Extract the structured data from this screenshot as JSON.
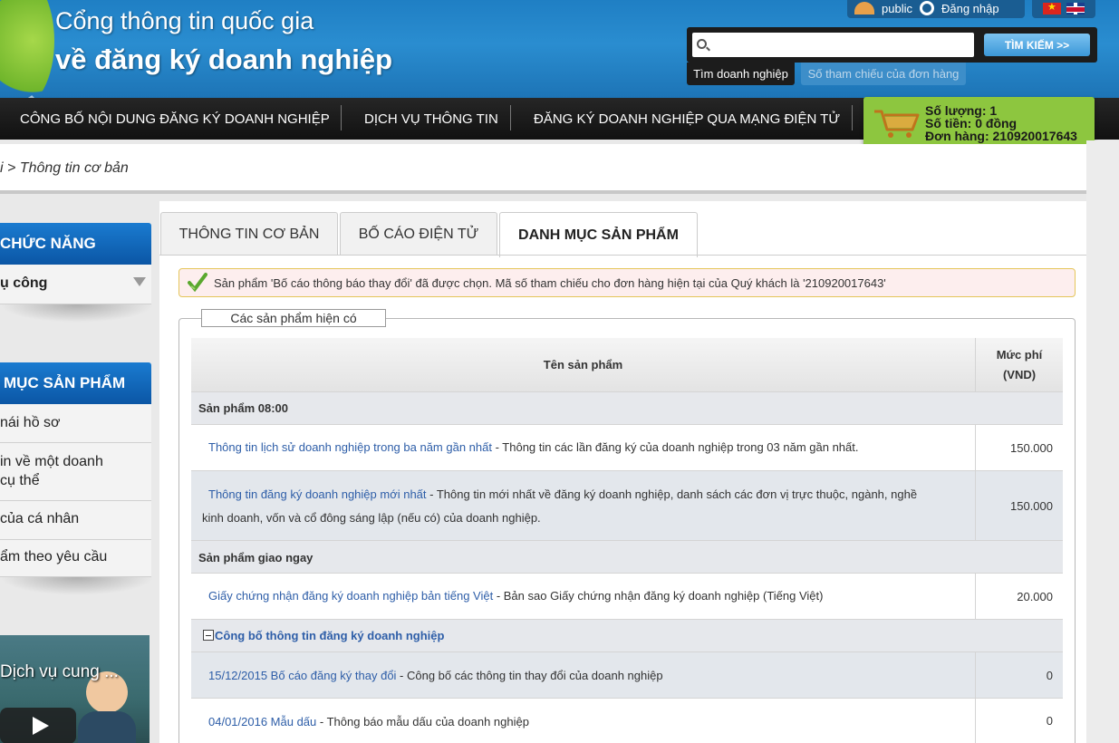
{
  "header": {
    "title_line1": "Cổng thông tin quốc gia",
    "title_line2": "về đăng ký doanh nghiệp",
    "user_name": "public",
    "login_label": "Đăng nhập"
  },
  "search": {
    "placeholder": "",
    "button_label": "TÌM KIẾM >>",
    "tabs": [
      "Tìm doanh nghiệp",
      "Số tham chiếu của đơn hàng"
    ]
  },
  "nav": {
    "items": [
      "CÔNG BỐ NỘI DUNG ĐĂNG KÝ DOANH NGHIỆP",
      "DỊCH VỤ THÔNG TIN",
      "ĐĂNG KÝ DOANH NGHIỆP QUA MẠNG ĐIỆN TỬ"
    ]
  },
  "cart": {
    "quantity": "Số lượng: 1",
    "amount": "Số tiền: 0 đồng",
    "order": "Đơn hàng: 210920017643"
  },
  "breadcrumb": {
    "text": "i > Thông tin cơ bản"
  },
  "sidebar": {
    "section1_title": "CHỨC NĂNG",
    "section1_items": [
      "ụ công"
    ],
    "section2_title": "MỤC SẢN PHẨM",
    "section2_items": [
      "nái hồ sơ",
      "in về một doanh",
      "cụ thể",
      "của cá nhân",
      "ẩm theo yêu cầu"
    ],
    "video_title": "Dịch vụ cung ..."
  },
  "tabs": [
    "THÔNG TIN CƠ BẢN",
    "BỐ CÁO ĐIỆN TỬ",
    "DANH MỤC SẢN PHẨM"
  ],
  "alert": {
    "message": "Sản phẩm 'Bố cáo thông báo thay đổi' đã được chọn. Mã số tham chiếu cho đơn hàng hiện tại của Quý khách là '210920017643'"
  },
  "products": {
    "legend": "Các sản phẩm hiện có",
    "col_name": "Tên sản phẩm",
    "col_fee_1": "Mức phí",
    "col_fee_2": "(VND)",
    "group1": "Sản phẩm 08:00",
    "row1_link": "Thông tin lịch sử doanh nghiệp trong ba năm gần nhất",
    "row1_desc": " - Thông tin các lần đăng ký của doanh nghiệp trong 03 năm gần nhất.",
    "row1_fee": "150.000",
    "row2_link": "Thông tin đăng ký doanh nghiệp mới nhất",
    "row2_desc": " - Thông tin mới nhất về đăng ký doanh nghiệp, danh sách các đơn vị trực thuộc, ngành, nghề",
    "row2_desc2": "kinh doanh, vốn và cổ đông sáng lập (nếu có) của doanh nghiệp.",
    "row2_fee": "150.000",
    "group2": "Sản phẩm giao ngay",
    "row3_link": "Giấy chứng nhận đăng ký doanh nghiệp bản tiếng Việt",
    "row3_desc": " - Bản sao Giấy chứng nhận đăng ký doanh nghiệp (Tiếng Việt)",
    "row3_fee": "20.000",
    "group3": "Công bố thông tin đăng ký doanh nghiệp",
    "row4_link": "15/12/2015 Bố cáo đăng ký thay đổi",
    "row4_desc": " - Công bố các thông tin thay đổi của doanh nghiệp",
    "row4_fee": "0",
    "row5_link": "04/01/2016 Mẫu dấu",
    "row5_desc": " - Thông báo mẫu dấu của doanh nghiệp",
    "row5_fee": "0"
  }
}
